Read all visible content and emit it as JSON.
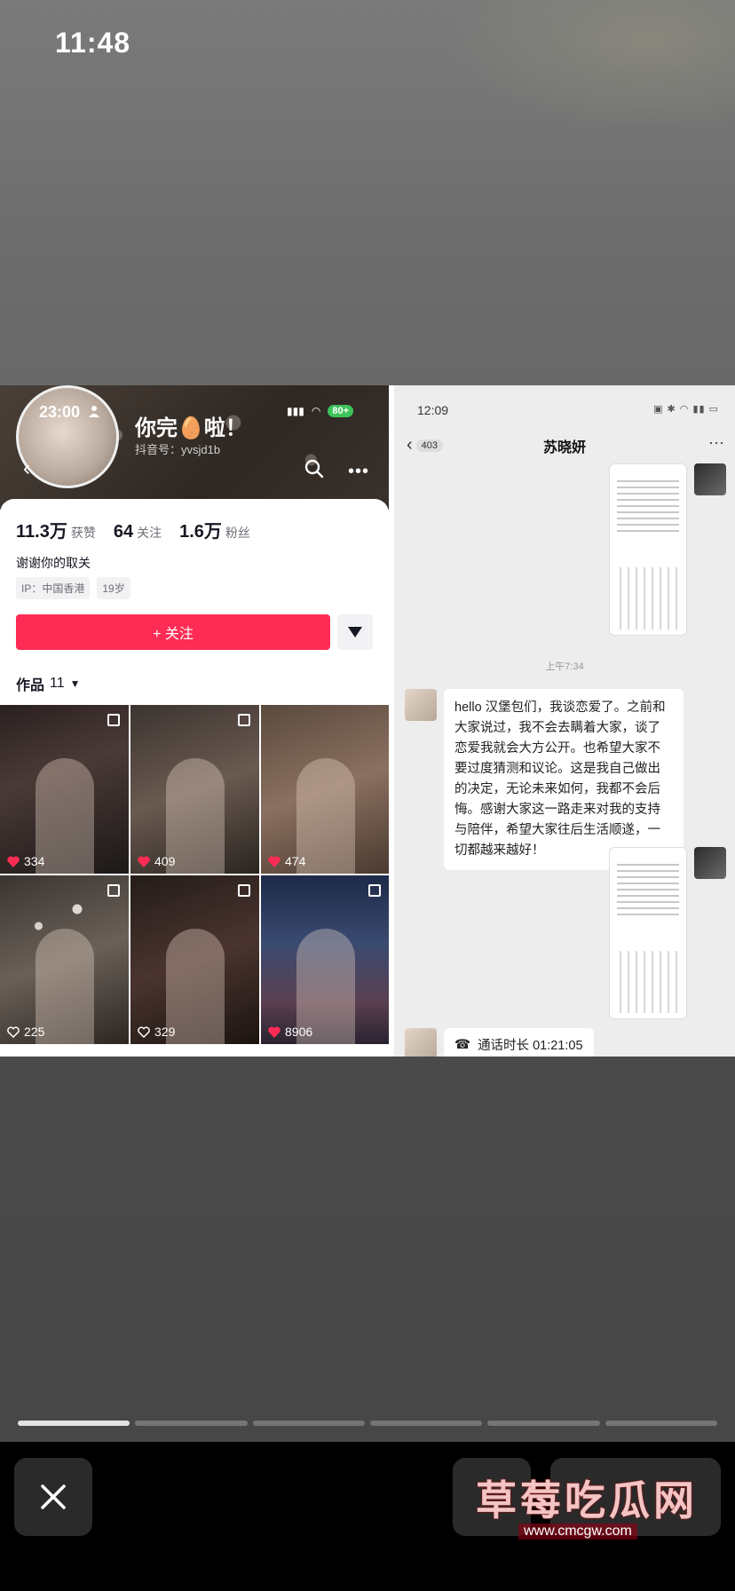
{
  "status_bar": {
    "time": "11:48"
  },
  "profile": {
    "phone_time": "23:00",
    "name": "你完🥚啦！",
    "account_id": "抖音号：yvsjd1b",
    "battery": "80+",
    "stats": [
      {
        "value": "11.3万",
        "label": "获赞"
      },
      {
        "value": "64",
        "label": "关注"
      },
      {
        "value": "1.6万",
        "label": "粉丝"
      }
    ],
    "bio": "谢谢你的取关",
    "tags": [
      "IP：中国香港",
      "19岁"
    ],
    "follow_label": "+ 关注",
    "works_label": "作品",
    "works_count": "11",
    "videos": [
      {
        "likes": "334",
        "liked": true,
        "multi": true
      },
      {
        "likes": "409",
        "liked": true,
        "multi": true
      },
      {
        "likes": "474",
        "liked": true,
        "multi": false
      },
      {
        "likes": "225",
        "liked": false,
        "multi": true
      },
      {
        "likes": "329",
        "liked": false,
        "multi": true
      },
      {
        "likes": "8906",
        "liked": true,
        "multi": true
      }
    ]
  },
  "chat": {
    "phone_time": "12:09",
    "back_count": "403",
    "contact_name": "苏晓妍",
    "timestamp": "上午7:34",
    "message": "hello 汉堡包们，我谈恋爱了。之前和大家说过，我不会去瞒着大家，谈了恋爱我就会大方公开。也希望大家不要过度猜测和议论。这是我自己做出的决定，无论未来如何，我都不会后悔。感谢大家这一路走来对我的支持与陪伴，希望大家往后生活顺遂，一切都越来越好！",
    "call_label": "通话时长 01:21:05"
  },
  "watermark": {
    "text": "草莓吃瓜网",
    "url": "www.cmcgw.com"
  },
  "progress": {
    "segments": 6,
    "active_index": 0
  },
  "colors": {
    "accent": "#fe2c55",
    "battery": "#3cc35a"
  }
}
